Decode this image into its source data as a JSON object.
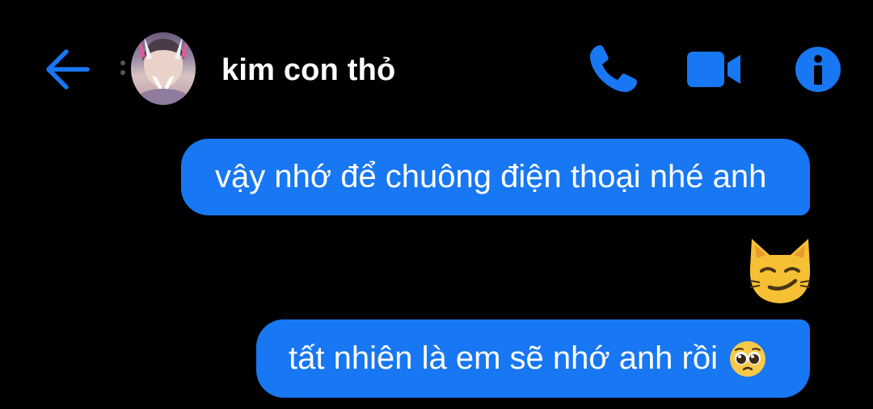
{
  "header": {
    "contact_name": "kim con thỏ",
    "back_icon": "arrow-left-icon",
    "call_icon": "phone-icon",
    "video_icon": "video-camera-icon",
    "info_icon": "info-icon"
  },
  "messages": [
    {
      "direction": "outgoing",
      "type": "text",
      "text": "vậy nhớ để chuông điện thoại nhé anh"
    },
    {
      "direction": "outgoing",
      "type": "emoji",
      "emoji": "smirking-cat-emoji"
    },
    {
      "direction": "outgoing",
      "type": "text",
      "text": "tất nhiên là em sẽ nhớ anh rồi",
      "trailing_emoji": "pleading-face-emoji"
    }
  ],
  "colors": {
    "background": "#000000",
    "accent": "#1877f2",
    "text": "#ffffff"
  }
}
